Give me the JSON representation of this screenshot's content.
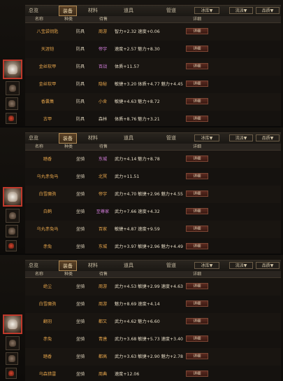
{
  "panels": [
    {
      "caption": "",
      "tabs": [
        "总览",
        "装备",
        "材料",
        "道具",
        "管道"
      ],
      "dropdowns": [
        "冰库▼",
        "流派▼",
        "品质▼"
      ],
      "header": [
        "名称",
        "种类",
        "",
        "待售",
        "详细"
      ],
      "rows": [
        {
          "name": "八宝袋钥匙",
          "cat": "防具",
          "src": "周游",
          "src_color": "#e2a24a",
          "attr": "智力+2.32 速度+0.06",
          "btn": "详细"
        },
        {
          "name": "天涯铠",
          "cat": "防具",
          "src": "帝宇",
          "src_color": "#d07cd8",
          "attr": "速度+2.57 魅力+8.30",
          "btn": "详细"
        },
        {
          "name": "金丝软甲",
          "cat": "防具",
          "src": "百战",
          "src_color": "#d07cd8",
          "attr": "体质+11.57",
          "btn": "详细"
        },
        {
          "name": "金丝软甲",
          "cat": "防具",
          "src": "隐秘",
          "src_color": "#e2a24a",
          "attr": "敏捷+3.20 体质+4.77 魅力+4.45",
          "btn": "详细"
        },
        {
          "name": "香囊集",
          "cat": "防具",
          "src": "小舍",
          "src_color": "#e2a24a",
          "attr": "敏捷+4.63 魅力+8.72",
          "btn": "详细"
        },
        {
          "name": "古甲",
          "cat": "防具",
          "src": "森林",
          "src_color": "#d8cdb6",
          "attr": "体质+8.76 魅力+3.21",
          "btn": "详细"
        }
      ]
    },
    {
      "caption": "",
      "tabs": [
        "总览",
        "装备",
        "材料",
        "道具",
        "管道"
      ],
      "dropdowns": [
        "冰库▼",
        "流派▼",
        "品质▼"
      ],
      "header": [
        "名称",
        "种类",
        "",
        "待售",
        "详细"
      ],
      "rows": [
        {
          "name": "踏香",
          "cat": "坐骑",
          "src": "东城",
          "src_color": "#d07cd8",
          "attr": "武力+4.14 魅力+8.78",
          "btn": "详细"
        },
        {
          "name": "乌丸赤兔马",
          "cat": "坐骑",
          "src": "北冥",
          "src_color": "#e2a24a",
          "attr": "武力+11.51",
          "btn": "详细"
        },
        {
          "name": "白雪魔驹",
          "cat": "坐骑",
          "src": "帝宇",
          "src_color": "#e2a24a",
          "attr": "武力+4.70 敏捷+2.96 魅力+4.55",
          "btn": "详细"
        },
        {
          "name": "白鹤",
          "cat": "坐骑",
          "src": "至尊家",
          "src_color": "#d07cd8",
          "attr": "武力+7.66 速度+4.32",
          "btn": "详细"
        },
        {
          "name": "乌丸赤兔马",
          "cat": "坐骑",
          "src": "百家",
          "src_color": "#e2a24a",
          "attr": "敏捷+4.87 速度+9.59",
          "btn": "详细"
        },
        {
          "name": "赤兔",
          "cat": "坐骑",
          "src": "东城",
          "src_color": "#e2a24a",
          "attr": "武力+3.97 敏捷+2.96 魅力+4.49",
          "btn": "详细"
        }
      ]
    },
    {
      "caption": "",
      "tabs": [
        "总览",
        "装备",
        "材料",
        "道具",
        "管道"
      ],
      "dropdowns": [
        "冰库▼",
        "流派▼",
        "品质▼"
      ],
      "header": [
        "名称",
        "种类",
        "",
        "待售",
        "详细"
      ],
      "rows": [
        {
          "name": "绝尘",
          "cat": "坐骑",
          "src": "周游",
          "src_color": "#e2a24a",
          "attr": "武力+4.53 敏捷+2.99 速度+4.63",
          "btn": "详细"
        },
        {
          "name": "白雪魔驹",
          "cat": "坐骑",
          "src": "周游",
          "src_color": "#e2a24a",
          "attr": "魅力+8.69 速度+4.14",
          "btn": "详细"
        },
        {
          "name": "翻羽",
          "cat": "坐骑",
          "src": "都又",
          "src_color": "#e2a24a",
          "attr": "武力+4.62 魅力+6.60",
          "btn": "详细"
        },
        {
          "name": "赤兔",
          "cat": "坐骑",
          "src": "青唐",
          "src_color": "#e2a24a",
          "attr": "武力+3.68 敏捷+5.73 速度+3.40",
          "btn": "详细"
        },
        {
          "name": "踏香",
          "cat": "坐骑",
          "src": "都高",
          "src_color": "#e2a24a",
          "attr": "武力+3.63 敏捷+2.90 魅力+2.78",
          "btn": "详细"
        },
        {
          "name": "乌森猎雷",
          "cat": "坐骑",
          "src": "周典",
          "src_color": "#e2a24a",
          "attr": "速度+12.06",
          "btn": "详细"
        }
      ]
    }
  ]
}
